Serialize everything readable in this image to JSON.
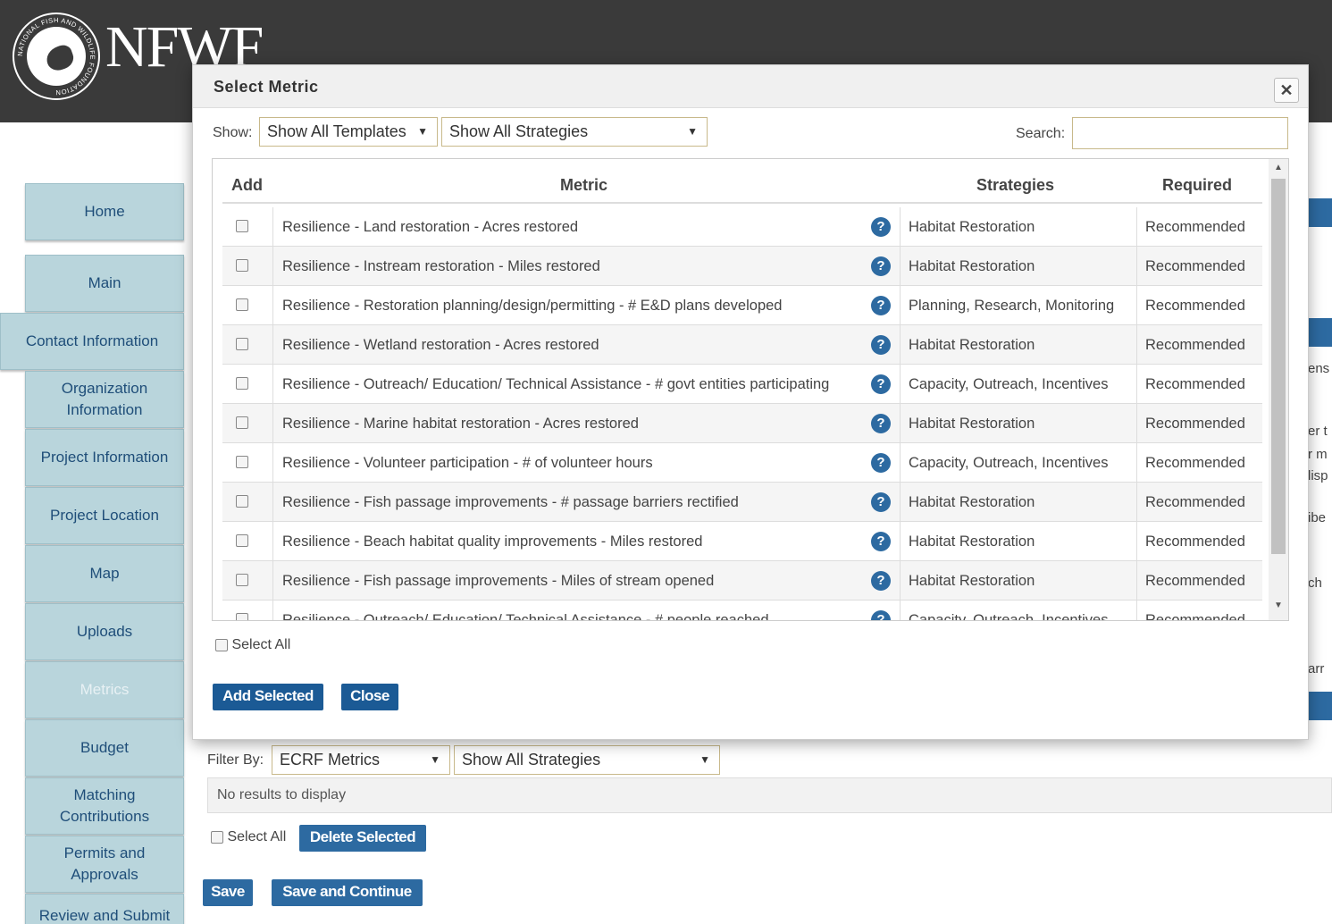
{
  "header": {
    "logo_text": "NFWF",
    "seal_text": "NATIONAL FISH AND WILDLIFE FOUNDATION"
  },
  "sidebar": {
    "items": [
      {
        "label": "Home"
      },
      {
        "label": "Main"
      },
      {
        "label": "Contact Information"
      },
      {
        "label": "Organization Information"
      },
      {
        "label": "Project Information"
      },
      {
        "label": "Project Location"
      },
      {
        "label": "Map"
      },
      {
        "label": "Uploads"
      },
      {
        "label": "Metrics"
      },
      {
        "label": "Budget"
      },
      {
        "label": "Matching Contributions"
      },
      {
        "label": "Permits and Approvals"
      },
      {
        "label": "Review and Submit"
      }
    ]
  },
  "background_page": {
    "right_fragments": [
      "ens",
      "er t",
      "r m",
      "lisp",
      "ibe",
      "ch",
      "arr"
    ],
    "filter_label": "Filter By:",
    "filter_template": "ECRF Metrics",
    "filter_strategy": "Show All Strategies",
    "no_results": "No results to display",
    "select_all": "Select All",
    "delete_selected": "Delete Selected",
    "save": "Save",
    "save_continue": "Save and Continue"
  },
  "modal": {
    "title": "Select Metric",
    "close_icon": "close-icon",
    "show_label": "Show:",
    "templates_select": "Show All Templates",
    "strategies_select": "Show All Strategies",
    "search_label": "Search:",
    "search_value": "",
    "columns": {
      "add": "Add",
      "metric": "Metric",
      "strategies": "Strategies",
      "required": "Required"
    },
    "rows": [
      {
        "metric": "Resilience - Land restoration - Acres restored",
        "strategies": "Habitat Restoration",
        "required": "Recommended"
      },
      {
        "metric": "Resilience - Instream restoration - Miles restored",
        "strategies": "Habitat Restoration",
        "required": "Recommended"
      },
      {
        "metric": "Resilience - Restoration planning/design/permitting - # E&D plans developed",
        "strategies": "Planning, Research, Monitoring",
        "required": "Recommended"
      },
      {
        "metric": "Resilience - Wetland restoration - Acres restored",
        "strategies": "Habitat Restoration",
        "required": "Recommended"
      },
      {
        "metric": "Resilience - Outreach/ Education/ Technical Assistance - # govt entities participating",
        "strategies": "Capacity, Outreach, Incentives",
        "required": "Recommended"
      },
      {
        "metric": "Resilience - Marine habitat restoration - Acres restored",
        "strategies": "Habitat Restoration",
        "required": "Recommended"
      },
      {
        "metric": "Resilience - Volunteer participation - # of volunteer hours",
        "strategies": "Capacity, Outreach, Incentives",
        "required": "Recommended"
      },
      {
        "metric": "Resilience - Fish passage improvements - # passage barriers rectified",
        "strategies": "Habitat Restoration",
        "required": "Recommended"
      },
      {
        "metric": "Resilience - Beach habitat quality improvements - Miles restored",
        "strategies": "Habitat Restoration",
        "required": "Recommended"
      },
      {
        "metric": "Resilience - Fish passage improvements - Miles of stream opened",
        "strategies": "Habitat Restoration",
        "required": "Recommended"
      },
      {
        "metric": "Resilience - Outreach/ Education/ Technical Assistance - # people reached",
        "strategies": "Capacity, Outreach, Incentives",
        "required": "Recommended"
      }
    ],
    "help_glyph": "?",
    "select_all": "Select All",
    "add_selected": "Add Selected",
    "close": "Close"
  },
  "colors": {
    "header_bg": "#3a3a3a",
    "sidebar_bg": "#b9d5dc",
    "primary_blue": "#2d6aa1",
    "dark_blue": "#1b5a95"
  }
}
